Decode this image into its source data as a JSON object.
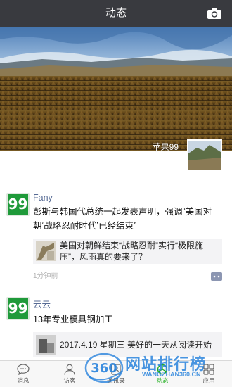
{
  "header": {
    "title": "动态",
    "camera_icon": "camera-icon"
  },
  "profile": {
    "name": "苹果99"
  },
  "posts": [
    {
      "avatar_text": "99",
      "name": "Fany",
      "text": "彭斯与韩国代总统一起发表声明，强调“美国对朝‘战略忍耐时代’已经结束”",
      "share_text": "美国对朝鲜结束“战略忍耐”实行“极限施压”，风雨真的要来了？",
      "time": "1分钟前"
    },
    {
      "avatar_text": "99",
      "name": "云云",
      "text": "13年专业模具钢加工",
      "share_text": "2017.4.19 星期三 美好的一天从阅读开始"
    }
  ],
  "tabs": [
    {
      "label": "消息",
      "icon": "chat-icon"
    },
    {
      "label": "访客",
      "icon": "person-icon"
    },
    {
      "label": "通讯录",
      "icon": "contacts-icon"
    },
    {
      "label": "动态",
      "icon": "moments-icon",
      "active": true
    },
    {
      "label": "应用",
      "icon": "apps-icon"
    }
  ],
  "watermark": {
    "badge": "360",
    "text": "网站排行榜",
    "url": "WANGZHAN360.CN"
  },
  "colors": {
    "header": "#393a3f",
    "name_link": "#576b95",
    "avatar": "#1f9a3a",
    "active_tab": "#1aad19"
  }
}
